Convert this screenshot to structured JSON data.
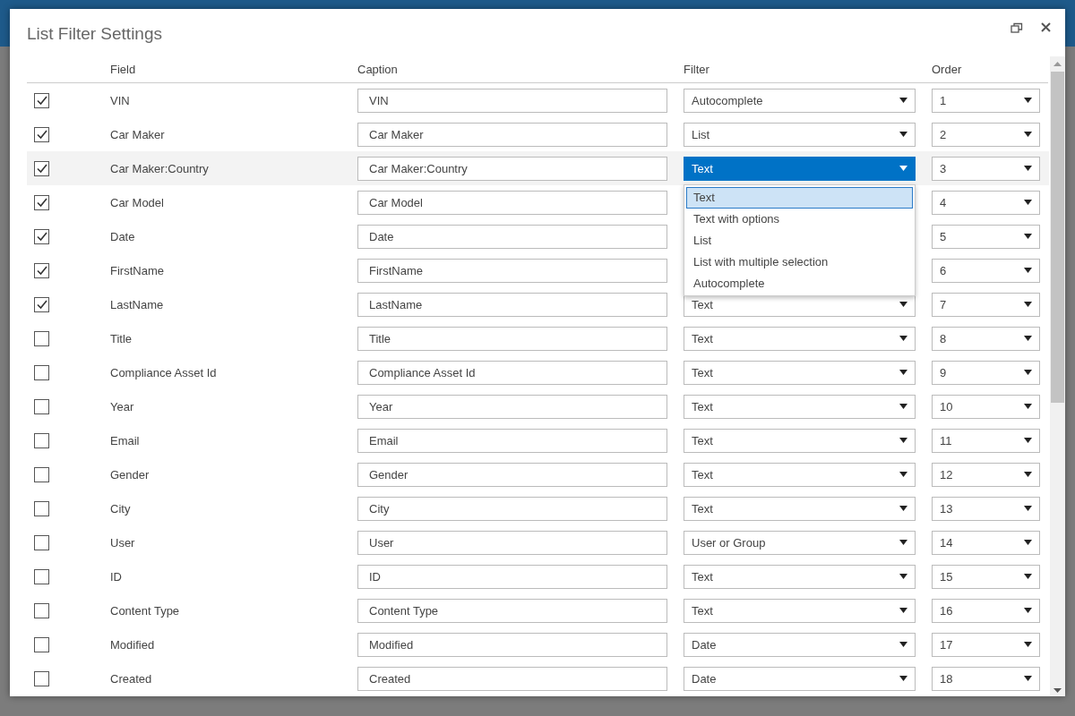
{
  "dialog": {
    "title": "List Filter Settings"
  },
  "columns": [
    "Field",
    "Caption",
    "Filter",
    "Order"
  ],
  "rows": [
    {
      "checked": true,
      "field": "VIN",
      "caption": "VIN",
      "filter": "Autocomplete",
      "order": "1",
      "highlighted": false,
      "open": false
    },
    {
      "checked": true,
      "field": "Car Maker",
      "caption": "Car Maker",
      "filter": "List",
      "order": "2",
      "highlighted": false,
      "open": false
    },
    {
      "checked": true,
      "field": "Car Maker:Country",
      "caption": "Car Maker:Country",
      "filter": "Text",
      "order": "3",
      "highlighted": true,
      "open": true,
      "options": [
        {
          "label": "Text",
          "selected": true
        },
        {
          "label": "Text with options",
          "selected": false
        },
        {
          "label": "List",
          "selected": false
        },
        {
          "label": "List with multiple selection",
          "selected": false
        },
        {
          "label": "Autocomplete",
          "selected": false
        }
      ]
    },
    {
      "checked": true,
      "field": "Car Model",
      "caption": "Car Model",
      "order": "4",
      "highlighted": false
    },
    {
      "checked": true,
      "field": "Date",
      "caption": "Date",
      "order": "5",
      "highlighted": false
    },
    {
      "checked": true,
      "field": "FirstName",
      "caption": "FirstName",
      "order": "6",
      "highlighted": false
    },
    {
      "checked": true,
      "field": "LastName",
      "caption": "LastName",
      "filter": "Text",
      "order": "7",
      "highlighted": false,
      "open": false
    },
    {
      "checked": false,
      "field": "Title",
      "caption": "Title",
      "filter": "Text",
      "order": "8",
      "highlighted": false,
      "open": false
    },
    {
      "checked": false,
      "field": "Compliance Asset Id",
      "caption": "Compliance Asset Id",
      "filter": "Text",
      "order": "9",
      "highlighted": false,
      "open": false
    },
    {
      "checked": false,
      "field": "Year",
      "caption": "Year",
      "filter": "Text",
      "order": "10",
      "highlighted": false,
      "open": false
    },
    {
      "checked": false,
      "field": "Email",
      "caption": "Email",
      "filter": "Text",
      "order": "11",
      "highlighted": false,
      "open": false
    },
    {
      "checked": false,
      "field": "Gender",
      "caption": "Gender",
      "filter": "Text",
      "order": "12",
      "highlighted": false,
      "open": false
    },
    {
      "checked": false,
      "field": "City",
      "caption": "City",
      "filter": "Text",
      "order": "13",
      "highlighted": false,
      "open": false
    },
    {
      "checked": false,
      "field": "User",
      "caption": "User",
      "filter": "User or Group",
      "order": "14",
      "highlighted": false,
      "open": false
    },
    {
      "checked": false,
      "field": "ID",
      "caption": "ID",
      "filter": "Text",
      "order": "15",
      "highlighted": false,
      "open": false
    },
    {
      "checked": false,
      "field": "Content Type",
      "caption": "Content Type",
      "filter": "Text",
      "order": "16",
      "highlighted": false,
      "open": false
    },
    {
      "checked": false,
      "field": "Modified",
      "caption": "Modified",
      "filter": "Date",
      "order": "17",
      "highlighted": false,
      "open": false
    },
    {
      "checked": false,
      "field": "Created",
      "caption": "Created",
      "filter": "Date",
      "order": "18",
      "highlighted": false,
      "open": false
    }
  ]
}
